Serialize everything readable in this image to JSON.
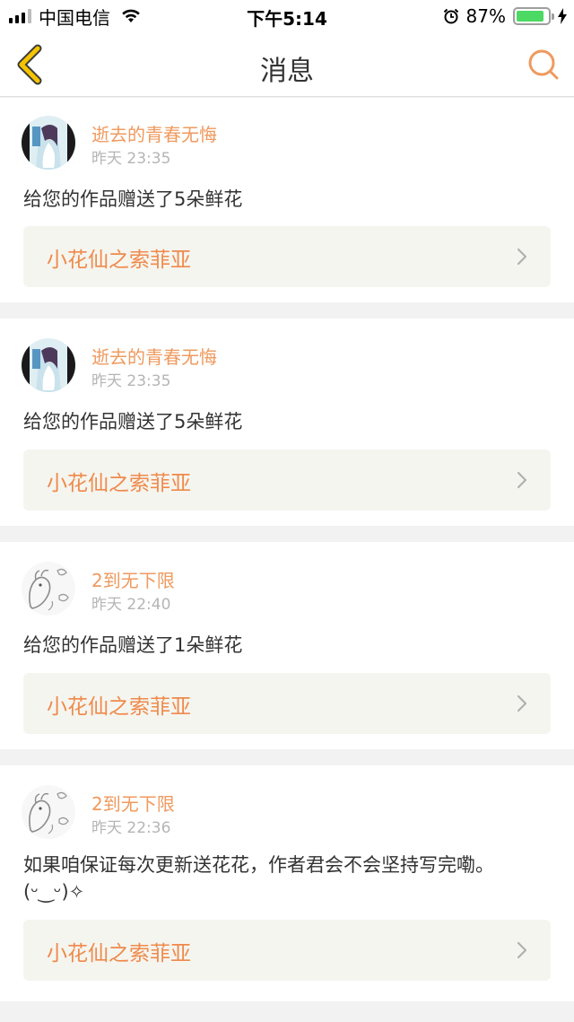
{
  "status_bar": {
    "carrier": "中国电信",
    "time": "下午5:14",
    "battery_percent_text": "87%",
    "battery_level": 0.87,
    "icons": [
      "signal-icon",
      "wifi-icon",
      "alarm-icon",
      "battery-icon",
      "charging-bolt-icon"
    ]
  },
  "nav": {
    "title": "消息",
    "back_icon": "chevron-left-icon",
    "search_icon": "search-icon"
  },
  "colors": {
    "accent_orange": "#ef8a4c",
    "username_orange": "#ef9a5f",
    "back_yellow": "#f5c400",
    "text_dark": "#333333",
    "meta_gray": "#b5b5b5",
    "link_bg": "#f5f5ef",
    "page_bg": "#f2f2f2"
  },
  "messages": [
    {
      "user": "逝去的青春无悔",
      "time": "昨天 23:35",
      "content": "给您的作品赠送了5朵鲜花",
      "work_title": "小花仙之索菲亚",
      "avatar": "book-cover-avatar"
    },
    {
      "user": "逝去的青春无悔",
      "time": "昨天 23:35",
      "content": "给您的作品赠送了5朵鲜花",
      "work_title": "小花仙之索菲亚",
      "avatar": "book-cover-avatar"
    },
    {
      "user": "2到无下限",
      "time": "昨天 22:40",
      "content": "给您的作品赠送了1朵鲜花",
      "work_title": "小花仙之索菲亚",
      "avatar": "sketch-avatar"
    },
    {
      "user": "2到无下限",
      "time": "昨天 22:36",
      "content": "如果咱保证每次更新送花花，作者君会不会坚持写完嘞。(ᵕ‿ᵕ)✧",
      "work_title": "小花仙之索菲亚",
      "avatar": "sketch-avatar"
    }
  ]
}
